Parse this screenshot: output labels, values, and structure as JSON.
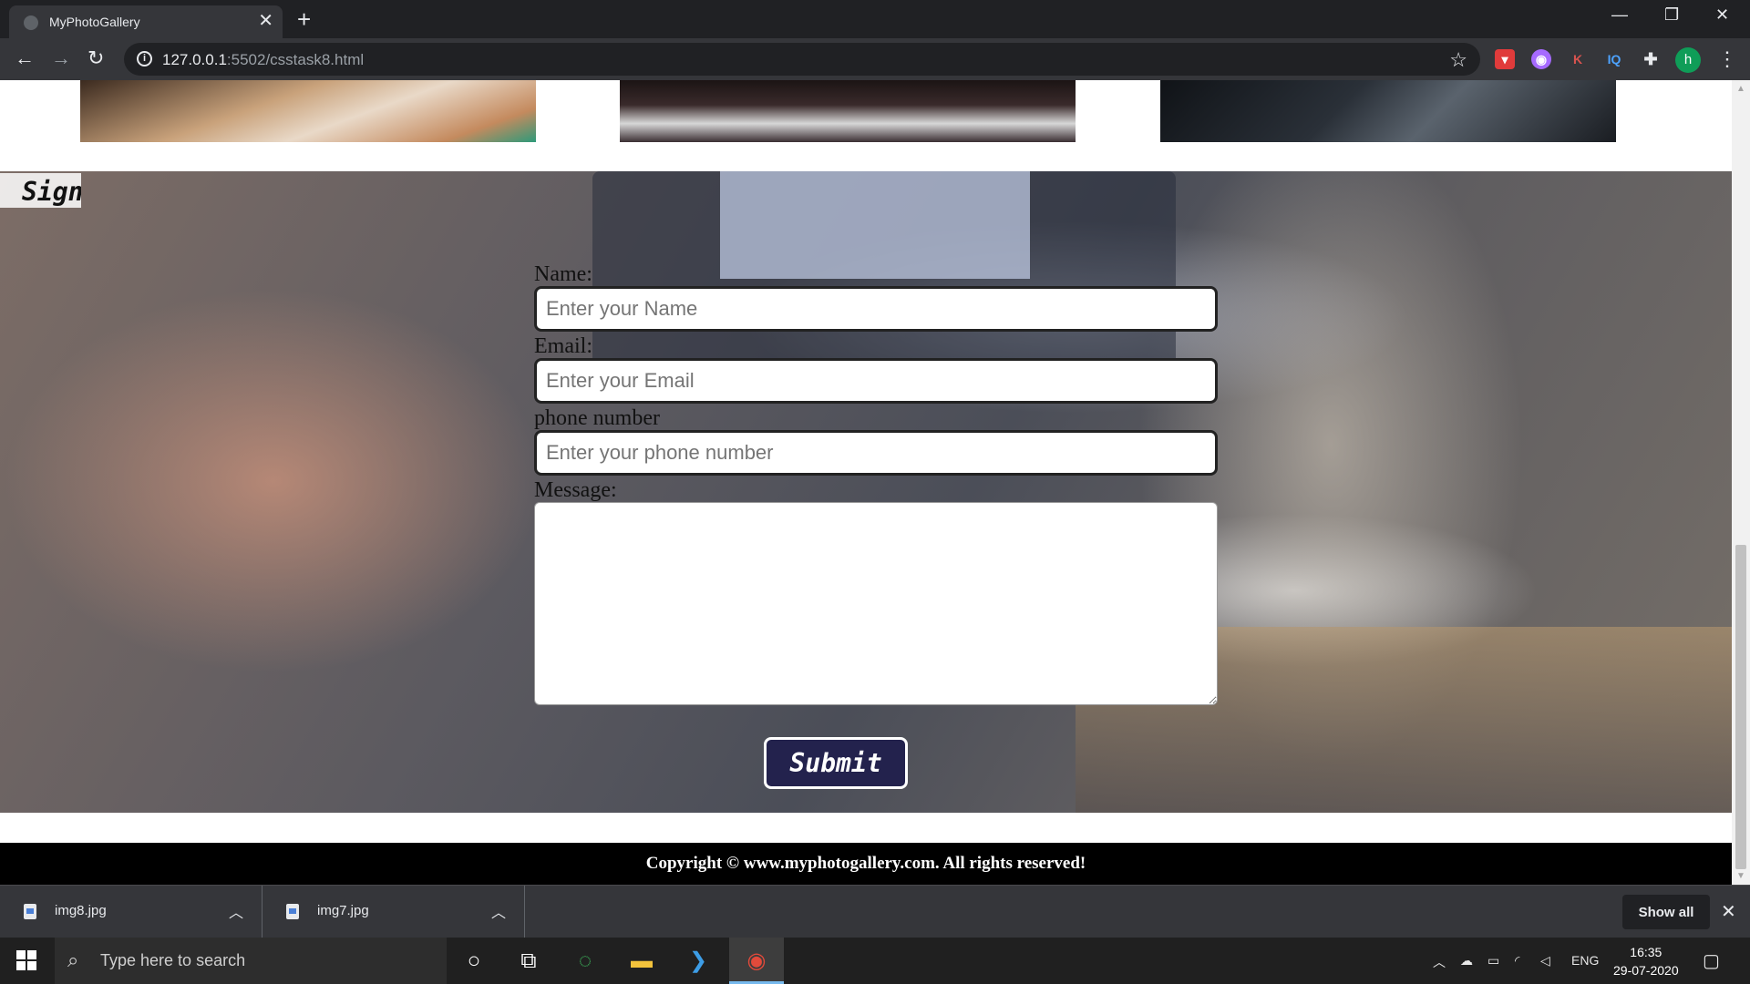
{
  "browser": {
    "tab_title": "MyPhotoGallery",
    "tab_close": "✕",
    "new_tab": "+",
    "url_host": "127.0.0.1",
    "url_path": ":5502/csstask8.html",
    "extensions": [
      "pocket-icon",
      "globe-extension-icon",
      "K",
      "IQ",
      "puzzle-icon"
    ],
    "profile_initial": "h"
  },
  "page": {
    "section_heading": "Sign Up",
    "form": {
      "name_label": "Name:",
      "name_placeholder": "Enter your Name",
      "email_label": "Email:",
      "email_placeholder": "Enter your Email",
      "phone_label": "phone number",
      "phone_placeholder": "Enter your phone number",
      "message_label": "Message:",
      "submit_label": "Submit"
    },
    "footer": "Copyright © www.myphotogallery.com. All rights reserved!"
  },
  "downloads": {
    "items": [
      {
        "name": "img8.jpg"
      },
      {
        "name": "img7.jpg"
      }
    ],
    "show_all": "Show all"
  },
  "taskbar": {
    "search_placeholder": "Type here to search",
    "language": "ENG",
    "time": "16:35",
    "date": "29-07-2020"
  },
  "colors": {
    "submit_bg": "#23224d",
    "footer_bg": "#000000",
    "profile_bg": "#0f9d58"
  }
}
